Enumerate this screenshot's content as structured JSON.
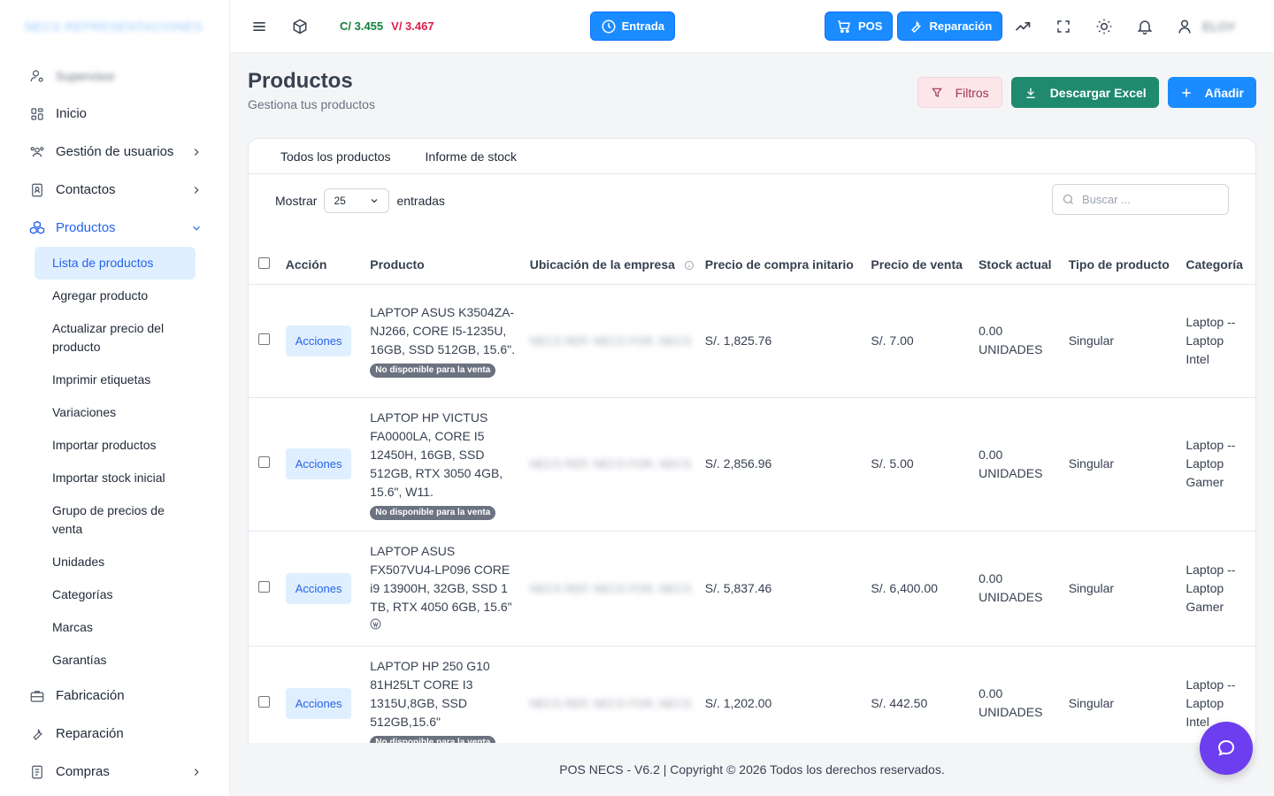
{
  "sidebar": {
    "brand": "NECS REPRESENTACIONES",
    "user": "Supervisor",
    "items": [
      {
        "label": "Inicio"
      },
      {
        "label": "Gestión de usuarios"
      },
      {
        "label": "Contactos"
      },
      {
        "label": "Productos"
      },
      {
        "label": "Fabricación"
      },
      {
        "label": "Reparación"
      },
      {
        "label": "Compras"
      }
    ],
    "sub_items": [
      {
        "label": "Lista de productos"
      },
      {
        "label": "Agregar producto"
      },
      {
        "label": "Actualizar precio del producto"
      },
      {
        "label": "Imprimir etiquetas"
      },
      {
        "label": "Variaciones"
      },
      {
        "label": "Importar productos"
      },
      {
        "label": "Importar stock inicial"
      },
      {
        "label": "Grupo de precios de venta"
      },
      {
        "label": "Unidades"
      },
      {
        "label": "Categorías"
      },
      {
        "label": "Marcas"
      },
      {
        "label": "Garantías"
      }
    ]
  },
  "topbar": {
    "rate_c": "C/ 3.455",
    "rate_v": "V/ 3.467",
    "entrada": "Entrada",
    "pos": "POS",
    "reparacion": "Reparación",
    "user_name": "ELOY"
  },
  "page": {
    "title": "Productos",
    "subtitle": "Gestiona tus productos",
    "filtros": "Filtros",
    "excel": "Descargar Excel",
    "add": "Añadir"
  },
  "tabs": [
    "Todos los productos",
    "Informe de stock"
  ],
  "controls": {
    "show": "Mostrar",
    "entries_value": "25",
    "entries": "entradas",
    "search_placeholder": "Buscar ..."
  },
  "table": {
    "headers": [
      "Acción",
      "Producto",
      "Ubicación de la empresa",
      "Precio de compra initario",
      "Precio de venta",
      "Stock actual",
      "Tipo de producto",
      "Categoría"
    ],
    "action_label": "Acciones",
    "rows": [
      {
        "product": "LAPTOP ASUS K3504ZA-NJ266, CORE I5-1235U, 16GB, SSD 512GB, 15.6\".",
        "badge": "No disponible para la venta",
        "location": "NECS REP, NECS FOR, NECS",
        "buy": "S/. 1,825.76",
        "sell": "S/. 7.00",
        "stock": "0.00 UNIDADES",
        "type": "Singular",
        "category": "Laptop -- Laptop Intel"
      },
      {
        "product": "LAPTOP HP VICTUS FA0000LA, CORE I5 12450H, 16GB, SSD 512GB, RTX 3050 4GB, 15.6\", W11.",
        "badge": "No disponible para la venta",
        "location": "NECS REP, NECS FOR, NECS",
        "buy": "S/. 2,856.96",
        "sell": "S/. 5.00",
        "stock": "0.00 UNIDADES",
        "type": "Singular",
        "category": "Laptop -- Laptop Gamer"
      },
      {
        "product": "LAPTOP ASUS FX507VU4-LP096 CORE i9 13900H, 32GB, SSD 1 TB, RTX 4050 6GB, 15.6\"",
        "badge": "",
        "location": "NECS REP, NECS FOR, NECS",
        "buy": "S/. 5,837.46",
        "sell": "S/. 6,400.00",
        "stock": "0.00 UNIDADES",
        "type": "Singular",
        "category": "Laptop -- Laptop Gamer"
      },
      {
        "product": "LAPTOP HP 250 G10 81H25LT CORE I3 1315U,8GB, SSD 512GB,15.6\"",
        "badge": "No disponible para la venta",
        "location": "NECS REP, NECS FOR, NECS",
        "buy": "S/. 1,202.00",
        "sell": "S/. 442.50",
        "stock": "0.00 UNIDADES",
        "type": "Singular",
        "category": "Laptop -- Laptop Intel"
      }
    ]
  },
  "footer": "POS NECS - V6.2 | Copyright © 2026 Todos los derechos reservados.",
  "colors": {
    "accent": "#1a8cff",
    "excel": "#1f8a6e",
    "rate_c": "#15803d",
    "rate_v": "#e11d48",
    "chat": "#6d3df0"
  }
}
